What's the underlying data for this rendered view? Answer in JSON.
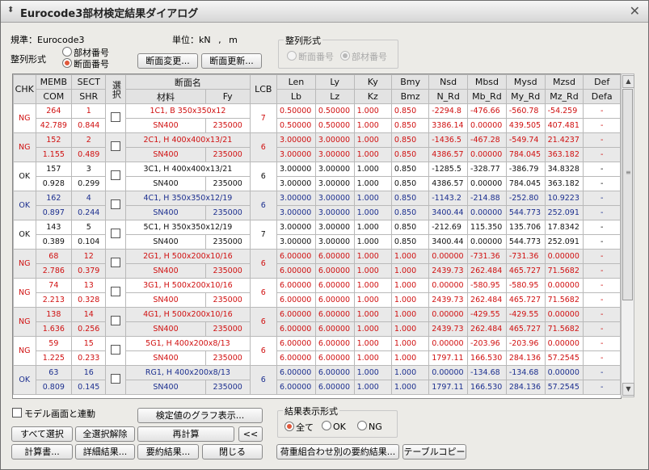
{
  "window": {
    "title": "Eurocode3部材検定結果ダイアログ"
  },
  "info": {
    "standard_label": "規準：Eurocode3",
    "unit_label": "単位：kN , m"
  },
  "sort": {
    "label": "整列形式",
    "options": [
      {
        "label": "部材番号",
        "selected": false
      },
      {
        "label": "断面番号",
        "selected": true
      }
    ],
    "group_label": "整列形式",
    "group_options": [
      {
        "label": "断面番号",
        "selected": false
      },
      {
        "label": "部材番号",
        "selected": true
      }
    ]
  },
  "buttons": {
    "section_change": "断面変更...",
    "section_update": "断面更新...",
    "graph": "検定値のグラフ表示...",
    "select_all": "すべて選択",
    "deselect_all": "全選択解除",
    "recalc": "再計算",
    "collapse": "<<",
    "calc_doc": "計算書...",
    "detail": "詳細結果...",
    "summary": "要約結果...",
    "close": "閉じる",
    "combo_summary": "荷重組合わせ別の要約結果...",
    "table_copy": "テーブルコピー"
  },
  "link": {
    "label": "モデル画面と連動"
  },
  "result_filter": {
    "label": "結果表示形式",
    "options": [
      {
        "label": "全て",
        "selected": true
      },
      {
        "label": "OK",
        "selected": false
      },
      {
        "label": "NG",
        "selected": false
      }
    ]
  },
  "grid": {
    "headers": {
      "chk": "CHK",
      "memb": "MEMB",
      "com": "COM",
      "sect": "SECT",
      "shr": "SHR",
      "sel": "選択",
      "secname": "断面名",
      "material": "材料",
      "fy": "Fy",
      "lcb": "LCB",
      "top": [
        "Len",
        "Ly",
        "Ky",
        "Bmy",
        "Nsd",
        "Mbsd",
        "Mysd",
        "Mzsd",
        "Def"
      ],
      "bottom": [
        "Lb",
        "Lz",
        "Kz",
        "Bmz",
        "N_Rd",
        "Mb_Rd",
        "My_Rd",
        "Mz_Rd",
        "Defa"
      ]
    },
    "rows": [
      {
        "chk": "NG",
        "memb": "264",
        "com": "42.789",
        "sect": "1",
        "shr": "0.844",
        "name": "1C1, B 350x350x12",
        "mat": "SN400",
        "fy": "235000",
        "lcb": "7",
        "top": [
          "0.50000",
          "0.50000",
          "1.000",
          "0.850",
          "-2294.8",
          "-476.66",
          "-560.78",
          "-54.259",
          "-"
        ],
        "bot": [
          "0.50000",
          "0.50000",
          "1.000",
          "0.850",
          "3386.14",
          "0.00000",
          "439.505",
          "407.481",
          "-"
        ],
        "color": "red",
        "shade": false
      },
      {
        "chk": "NG",
        "memb": "152",
        "com": "1.155",
        "sect": "2",
        "shr": "0.489",
        "name": "2C1, H 400x400x13/21",
        "mat": "SN400",
        "fy": "235000",
        "lcb": "6",
        "top": [
          "3.00000",
          "3.00000",
          "1.000",
          "0.850",
          "-1436.5",
          "-467.28",
          "-549.74",
          "21.4237",
          "-"
        ],
        "bot": [
          "3.00000",
          "3.00000",
          "1.000",
          "0.850",
          "4386.57",
          "0.00000",
          "784.045",
          "363.182",
          "-"
        ],
        "color": "red",
        "shade": true
      },
      {
        "chk": "OK",
        "memb": "157",
        "com": "0.928",
        "sect": "3",
        "shr": "0.299",
        "name": "3C1, H 400x400x13/21",
        "mat": "SN400",
        "fy": "235000",
        "lcb": "6",
        "top": [
          "3.00000",
          "3.00000",
          "1.000",
          "0.850",
          "-1285.5",
          "-328.77",
          "-386.79",
          "34.8328",
          "-"
        ],
        "bot": [
          "3.00000",
          "3.00000",
          "1.000",
          "0.850",
          "4386.57",
          "0.00000",
          "784.045",
          "363.182",
          "-"
        ],
        "color": "black",
        "shade": false
      },
      {
        "chk": "OK",
        "memb": "162",
        "com": "0.897",
        "sect": "4",
        "shr": "0.244",
        "name": "4C1, H 350x350x12/19",
        "mat": "SN400",
        "fy": "235000",
        "lcb": "6",
        "top": [
          "3.00000",
          "3.00000",
          "1.000",
          "0.850",
          "-1143.2",
          "-214.88",
          "-252.80",
          "10.9223",
          "-"
        ],
        "bot": [
          "3.00000",
          "3.00000",
          "1.000",
          "0.850",
          "3400.44",
          "0.00000",
          "544.773",
          "252.091",
          "-"
        ],
        "color": "blue",
        "shade": true
      },
      {
        "chk": "OK",
        "memb": "143",
        "com": "0.389",
        "sect": "5",
        "shr": "0.104",
        "name": "5C1, H 350x350x12/19",
        "mat": "SN400",
        "fy": "235000",
        "lcb": "7",
        "top": [
          "3.00000",
          "3.00000",
          "1.000",
          "0.850",
          "-212.69",
          "115.350",
          "135.706",
          "17.8342",
          "-"
        ],
        "bot": [
          "3.00000",
          "3.00000",
          "1.000",
          "0.850",
          "3400.44",
          "0.00000",
          "544.773",
          "252.091",
          "-"
        ],
        "color": "black",
        "shade": false
      },
      {
        "chk": "NG",
        "memb": "68",
        "com": "2.786",
        "sect": "12",
        "shr": "0.379",
        "name": "2G1, H 500x200x10/16",
        "mat": "SN400",
        "fy": "235000",
        "lcb": "6",
        "top": [
          "6.00000",
          "6.00000",
          "1.000",
          "1.000",
          "0.00000",
          "-731.36",
          "-731.36",
          "0.00000",
          "-"
        ],
        "bot": [
          "6.00000",
          "6.00000",
          "1.000",
          "1.000",
          "2439.73",
          "262.484",
          "465.727",
          "71.5682",
          "-"
        ],
        "color": "red",
        "shade": true
      },
      {
        "chk": "NG",
        "memb": "74",
        "com": "2.213",
        "sect": "13",
        "shr": "0.328",
        "name": "3G1, H 500x200x10/16",
        "mat": "SN400",
        "fy": "235000",
        "lcb": "6",
        "top": [
          "6.00000",
          "6.00000",
          "1.000",
          "1.000",
          "0.00000",
          "-580.95",
          "-580.95",
          "0.00000",
          "-"
        ],
        "bot": [
          "6.00000",
          "6.00000",
          "1.000",
          "1.000",
          "2439.73",
          "262.484",
          "465.727",
          "71.5682",
          "-"
        ],
        "color": "red",
        "shade": false
      },
      {
        "chk": "NG",
        "memb": "138",
        "com": "1.636",
        "sect": "14",
        "shr": "0.256",
        "name": "4G1, H 500x200x10/16",
        "mat": "SN400",
        "fy": "235000",
        "lcb": "6",
        "top": [
          "6.00000",
          "6.00000",
          "1.000",
          "1.000",
          "0.00000",
          "-429.55",
          "-429.55",
          "0.00000",
          "-"
        ],
        "bot": [
          "6.00000",
          "6.00000",
          "1.000",
          "1.000",
          "2439.73",
          "262.484",
          "465.727",
          "71.5682",
          "-"
        ],
        "color": "red",
        "shade": true
      },
      {
        "chk": "NG",
        "memb": "59",
        "com": "1.225",
        "sect": "15",
        "shr": "0.233",
        "name": "5G1, H 400x200x8/13",
        "mat": "SN400",
        "fy": "235000",
        "lcb": "6",
        "top": [
          "6.00000",
          "6.00000",
          "1.000",
          "1.000",
          "0.00000",
          "-203.96",
          "-203.96",
          "0.00000",
          "-"
        ],
        "bot": [
          "6.00000",
          "6.00000",
          "1.000",
          "1.000",
          "1797.11",
          "166.530",
          "284.136",
          "57.2545",
          "-"
        ],
        "color": "red",
        "shade": false
      },
      {
        "chk": "OK",
        "memb": "63",
        "com": "0.809",
        "sect": "16",
        "shr": "0.145",
        "name": "RG1, H 400x200x8/13",
        "mat": "SN400",
        "fy": "235000",
        "lcb": "6",
        "top": [
          "6.00000",
          "6.00000",
          "1.000",
          "1.000",
          "0.00000",
          "-134.68",
          "-134.68",
          "0.00000",
          "-"
        ],
        "bot": [
          "6.00000",
          "6.00000",
          "1.000",
          "1.000",
          "1797.11",
          "166.530",
          "284.136",
          "57.2545",
          "-"
        ],
        "color": "blue",
        "shade": true
      }
    ]
  },
  "colors": {
    "ng": "#d01010",
    "ok_blue": "#1c2f8f",
    "accent": "#e0583a"
  }
}
